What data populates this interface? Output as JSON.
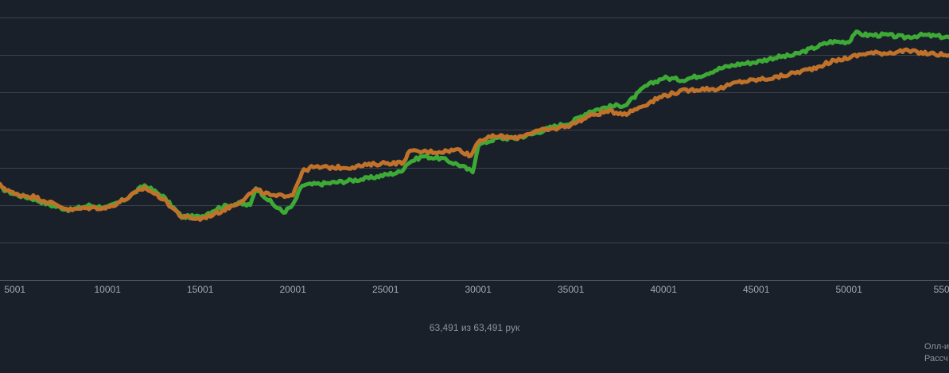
{
  "chart_data": {
    "type": "line",
    "x_ticks": [
      "5001",
      "10001",
      "15001",
      "20001",
      "25001",
      "30001",
      "35001",
      "40001",
      "45001",
      "50001",
      "550"
    ],
    "xlim": [
      4200,
      55400
    ],
    "ylim": [
      0,
      100
    ],
    "grid": true,
    "series": [
      {
        "color": "#3eaa36",
        "points": [
          [
            4200,
            27
          ],
          [
            5000,
            24
          ],
          [
            6000,
            22
          ],
          [
            7000,
            19
          ],
          [
            8000,
            17
          ],
          [
            9000,
            19
          ],
          [
            10000,
            18
          ],
          [
            11000,
            22
          ],
          [
            12000,
            28
          ],
          [
            13000,
            23
          ],
          [
            14000,
            14
          ],
          [
            15000,
            14
          ],
          [
            16000,
            18
          ],
          [
            17000,
            20
          ],
          [
            17700,
            19
          ],
          [
            18000,
            27
          ],
          [
            19000,
            19
          ],
          [
            19500,
            16
          ],
          [
            20000,
            19
          ],
          [
            20500,
            28
          ],
          [
            22000,
            29
          ],
          [
            24000,
            31
          ],
          [
            25800,
            34
          ],
          [
            26200,
            38
          ],
          [
            27000,
            41
          ],
          [
            28000,
            40
          ],
          [
            29000,
            37
          ],
          [
            29700,
            34
          ],
          [
            30000,
            46
          ],
          [
            31000,
            49
          ],
          [
            32000,
            49
          ],
          [
            33000,
            51
          ],
          [
            34000,
            54
          ],
          [
            35000,
            56
          ],
          [
            36000,
            61
          ],
          [
            37000,
            63
          ],
          [
            38000,
            64
          ],
          [
            39000,
            72
          ],
          [
            40000,
            76
          ],
          [
            41000,
            75
          ],
          [
            42000,
            77
          ],
          [
            43000,
            80
          ],
          [
            44000,
            82
          ],
          [
            45000,
            83
          ],
          [
            46000,
            85
          ],
          [
            47000,
            86
          ],
          [
            48000,
            89
          ],
          [
            49000,
            92
          ],
          [
            50000,
            92
          ],
          [
            50300,
            96
          ],
          [
            51000,
            95
          ],
          [
            52000,
            95
          ],
          [
            53000,
            94
          ],
          [
            54000,
            95
          ],
          [
            55400,
            94
          ]
        ]
      },
      {
        "color": "#c0722a",
        "points": [
          [
            4200,
            28
          ],
          [
            5000,
            24
          ],
          [
            6000,
            23
          ],
          [
            7000,
            20
          ],
          [
            8000,
            17
          ],
          [
            9000,
            18
          ],
          [
            10000,
            18
          ],
          [
            11000,
            22
          ],
          [
            12000,
            27
          ],
          [
            13000,
            22
          ],
          [
            14000,
            14
          ],
          [
            15000,
            13
          ],
          [
            16000,
            16
          ],
          [
            17000,
            20
          ],
          [
            18000,
            26
          ],
          [
            19000,
            23
          ],
          [
            20000,
            24
          ],
          [
            20500,
            34
          ],
          [
            21000,
            36
          ],
          [
            22000,
            36
          ],
          [
            23000,
            36
          ],
          [
            24000,
            37
          ],
          [
            25000,
            38
          ],
          [
            26000,
            38
          ],
          [
            26200,
            43
          ],
          [
            27000,
            43
          ],
          [
            28000,
            43
          ],
          [
            29000,
            44
          ],
          [
            29600,
            41
          ],
          [
            30000,
            48
          ],
          [
            31000,
            50
          ],
          [
            32000,
            49
          ],
          [
            33000,
            52
          ],
          [
            34000,
            53
          ],
          [
            35000,
            55
          ],
          [
            36000,
            59
          ],
          [
            37000,
            61
          ],
          [
            38000,
            60
          ],
          [
            39000,
            64
          ],
          [
            40000,
            68
          ],
          [
            41000,
            70
          ],
          [
            42000,
            71
          ],
          [
            43000,
            71
          ],
          [
            44000,
            74
          ],
          [
            45000,
            75
          ],
          [
            46000,
            76
          ],
          [
            47000,
            78
          ],
          [
            48000,
            80
          ],
          [
            49000,
            83
          ],
          [
            50000,
            85
          ],
          [
            51000,
            87
          ],
          [
            52000,
            87
          ],
          [
            53000,
            88
          ],
          [
            54000,
            87
          ],
          [
            55400,
            86
          ]
        ]
      }
    ]
  },
  "hand_count_text": "63,491 из 63,491 рук",
  "footnote_line1": "Олл-и",
  "footnote_line2": "Рассч"
}
